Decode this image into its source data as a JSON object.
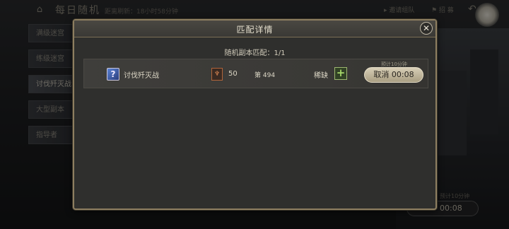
{
  "header": {
    "title": "每日随机",
    "refresh": "距离刷新：18小时58分钟",
    "invite": "邀请组队",
    "recruit": "招 募"
  },
  "sidebar": {
    "items": [
      {
        "label": "满级迷宫"
      },
      {
        "label": "练级迷宫"
      },
      {
        "label": "讨伐歼灭战"
      },
      {
        "label": "大型副本"
      },
      {
        "label": "指导者"
      }
    ]
  },
  "background_timer": {
    "label": "预计10分钟",
    "value": "00:08"
  },
  "modal": {
    "title": "匹配详情",
    "match_count": "随机副本匹配：1/1",
    "row": {
      "dungeon_name": "讨伐歼灭战",
      "level": "50",
      "rank": "第 494",
      "scarce": "稀缺",
      "estimate": "预计10分钟",
      "cancel": "取消 00:08"
    }
  }
}
